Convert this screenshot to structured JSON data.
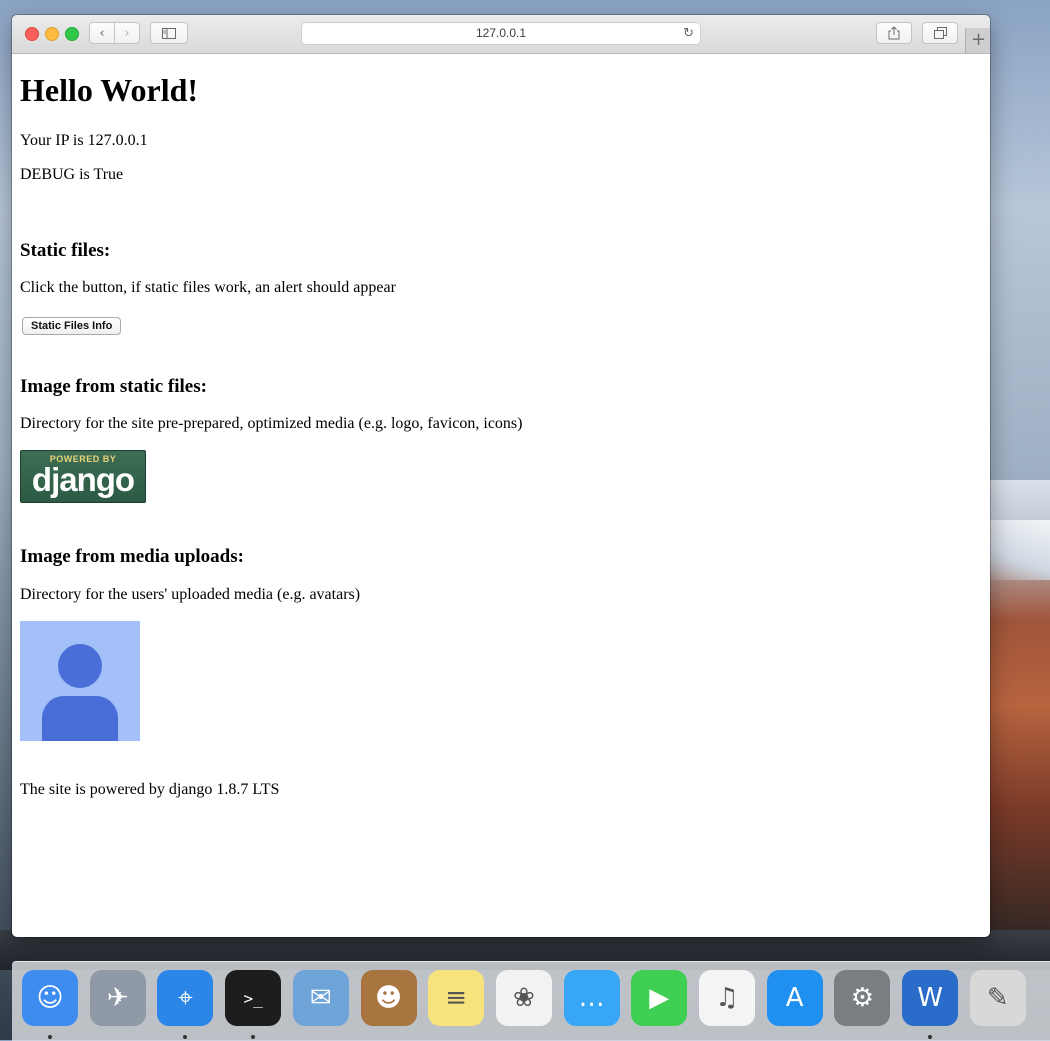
{
  "browser": {
    "address": "127.0.0.1",
    "new_tab": "+"
  },
  "page": {
    "heading": "Hello World!",
    "ip_line": "Your IP is 127.0.0.1",
    "debug_line": "DEBUG is True",
    "static_files_heading": "Static files:",
    "static_files_text": "Click the button, if static files work, an alert should appear",
    "static_files_button": "Static Files Info",
    "image_static_heading": "Image from static files:",
    "image_static_text": "Directory for the site pre-prepared, optimized media (e.g. logo, favicon, icons)",
    "django_logo": {
      "top_text": "POWERED BY",
      "main_text": "django"
    },
    "image_media_heading": "Image from media uploads:",
    "image_media_text": "Directory for the users' uploaded media (e.g. avatars)",
    "footer": "The site is powered by django 1.8.7 LTS"
  },
  "dock": {
    "items": [
      {
        "name": "finder-icon",
        "color": "#3d8cf0",
        "running": true
      },
      {
        "name": "launchpad-icon",
        "color": "#8f9aa6",
        "running": false
      },
      {
        "name": "safari-icon",
        "color": "#2c86e8",
        "running": true
      },
      {
        "name": "terminal-icon",
        "color": "#1d1d1d",
        "running": true
      },
      {
        "name": "mail-icon",
        "color": "#6fa4d8",
        "running": false
      },
      {
        "name": "contacts-icon",
        "color": "#a8743f",
        "running": false
      },
      {
        "name": "notes-icon",
        "color": "#f7e37c",
        "running": false
      },
      {
        "name": "photos-icon",
        "color": "#f2f2f2",
        "running": false
      },
      {
        "name": "messages-icon",
        "color": "#37a7f5",
        "running": false
      },
      {
        "name": "facetime-icon",
        "color": "#3fcf52",
        "running": false
      },
      {
        "name": "itunes-icon",
        "color": "#f4f4f4",
        "running": false
      },
      {
        "name": "app-store-icon",
        "color": "#1f8ff0",
        "running": false
      },
      {
        "name": "system-preferences-icon",
        "color": "#7a7d82",
        "running": false
      },
      {
        "name": "webstorm-icon",
        "color": "#2a6cc9",
        "running": true
      },
      {
        "name": "script-editor-icon",
        "color": "#d8d8d8",
        "running": false
      }
    ]
  }
}
